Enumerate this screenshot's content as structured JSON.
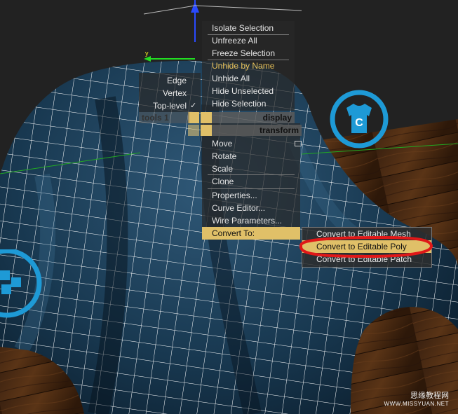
{
  "quad_menu": {
    "display_items": [
      {
        "label": "Isolate Selection"
      },
      {
        "label": "Unfreeze All"
      },
      {
        "label": "Freeze Selection"
      },
      {
        "label": "Unhide by Name"
      },
      {
        "label": "Unhide All"
      },
      {
        "label": "Hide Unselected"
      },
      {
        "label": "Hide Selection"
      }
    ],
    "subobject_levels": [
      {
        "label": "Edge"
      },
      {
        "label": "Vertex"
      },
      {
        "label": "Top-level",
        "checked": true
      }
    ],
    "checkmark": "✓",
    "tools1_header": "tools 1",
    "display_header": "display",
    "transform_header": "transform",
    "transform_items": [
      {
        "label": "Move"
      },
      {
        "label": "Rotate"
      },
      {
        "label": "Scale"
      },
      {
        "label": "Clone"
      },
      {
        "label": "Properties..."
      },
      {
        "label": "Curve Editor..."
      },
      {
        "label": "Wire Parameters..."
      },
      {
        "label": "Convert To:",
        "highlighted": true,
        "submenu_arrow": "▶"
      }
    ],
    "convert_submenu": [
      {
        "label": "Convert to Editable Mesh"
      },
      {
        "label": "Convert to Editable Poly",
        "highlighted": true,
        "annotated": true
      },
      {
        "label": "Convert to Editable Patch"
      }
    ]
  },
  "gizmo": {
    "y_axis_label": "y"
  },
  "badges": {
    "right_badge_letter": "C",
    "right_badge_icon": "tshirt-icon",
    "left_badge_icon": "cubes-icon"
  },
  "watermark": {
    "line1": "思缘教程网",
    "line2": "WWW.MISSYUAN.NET"
  },
  "colors": {
    "highlight": "#e0c068",
    "annotation": "#e01818",
    "badge": "#1e9ad6",
    "unhide_by_name": "#e8c25a"
  }
}
